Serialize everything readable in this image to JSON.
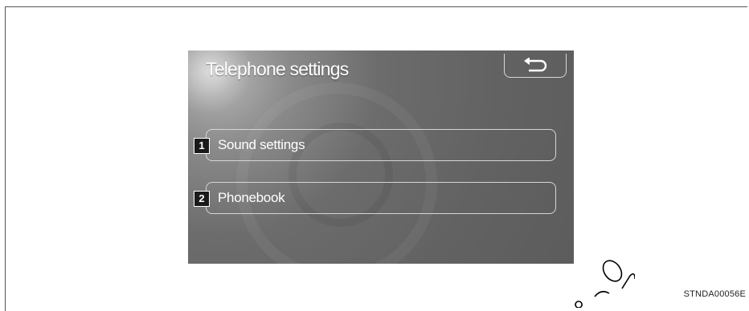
{
  "screen": {
    "title": "Telephone settings",
    "back_icon": "return-arrow-icon",
    "menu": [
      {
        "number": "1",
        "label": "Sound settings"
      },
      {
        "number": "2",
        "label": "Phonebook"
      }
    ]
  },
  "figure_code": "STNDA00056E",
  "colors": {
    "screen_background": "#626262",
    "button_border": "#d6d6d6",
    "text": "#ffffff",
    "badge_background": "#1a1a1a"
  }
}
